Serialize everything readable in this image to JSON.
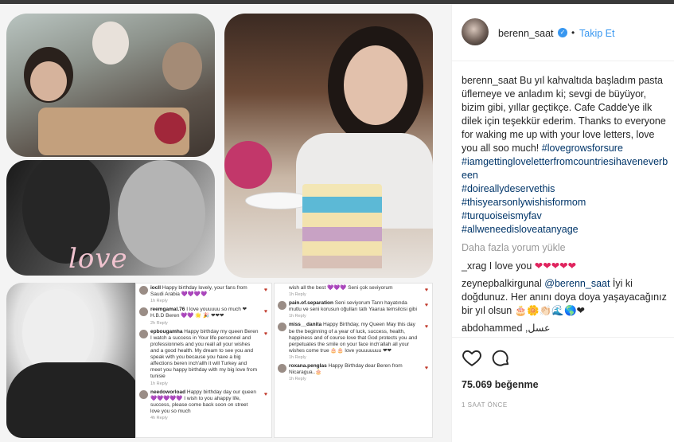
{
  "post": {
    "username": "berenn_saat",
    "follow_label": "Takip Et",
    "dot": "•",
    "verified_mark": "✓",
    "caption": "Bu yıl kahvaltıda başladım pasta üflemeye ve anladım ki; sevgi de büyüyor, bizim gibi, yıllar geçtikçe. Cafe Cadde'ye ilk dilek için teşekkür ederim. Thanks to everyone for waking me up with your love letters, love you all soo much!",
    "hashtags": [
      "#lovegrowsforsure",
      "#iamgettingloveletterfromcountriesihaveneverbeen",
      "#doireallydeservethis",
      "#thisyearsonlywishisformom",
      "#turquoiseismyfav",
      "#allweneedisloveatanyage"
    ],
    "load_more": "Daha fazla yorum yükle",
    "comments": [
      {
        "user": "_xrag",
        "text": "I love you ",
        "hearts": "❤❤❤❤❤"
      },
      {
        "user": "zeynepbalkirgunal",
        "mention": "@berenn_saat",
        "text": " İyi ki doğdunuz. Her anını doya doya yaşayacağınız bir yıl olsun ",
        "emoji": "🎂🌼👏🏻🌊🌎❤"
      },
      {
        "user": "abdohammed",
        "text": " ,عسل"
      }
    ],
    "likes": "75.069 beğenme",
    "time": "1 SAAT ÖNCE"
  },
  "collage": {
    "love_word": "love",
    "left_comments": [
      {
        "user": "iocll",
        "text": "Happy birthday lovely, your fans from Saudi Arabia 💜💜💜💜",
        "meta": "1h   Reply"
      },
      {
        "user": "reemgamal.76",
        "text": "I love youuuuu so much ❤ H.B.D Beren 💜💜 🌟 🎉 ❤❤❤",
        "meta": "2h   Reply"
      },
      {
        "user": "epbougamha",
        "text": "Happy birthday my queen Beren I watch a success in Your life personnel and professionnels and you reall all your wishes and a good health. My dream to see you and speak with you because you have a big affections beren inch'allh it will Turkey and meet you happy birthday with my big love from tunisie",
        "meta": "1h   Reply"
      },
      {
        "user": "needoworload",
        "text": "Happy birthday day our queen 💜💜💜💜💜 I wish to you ahappy life, success, please come back soon on street love you so much",
        "meta": "4h   Reply"
      }
    ],
    "right_comments": [
      {
        "user": "",
        "text": "wish all the best 💜💜💜 Seni çok seviyorum",
        "meta": "1h   Reply"
      },
      {
        "user": "pain.of.separation",
        "text": "Seni seviyorum Tanrı hayatında mutlu ve seni korusun oğulları tatlı Yaarua temsilcisi gibi",
        "meta": "1h   Reply"
      },
      {
        "user": "miss__danita",
        "text": "Happy Birthday, my Queen May this day be the beginning of a year of luck, success, health, happiness and of course love that God protects you and perpetuates the smile on your face inch'allah all your wishes come true 🎂🎂 love youuuuuuu ❤❤",
        "meta": "1h   Reply"
      },
      {
        "user": "roxana.penglas",
        "text": "Happy Birthday dear Beren from Nicaragua..🎂",
        "meta": "1h   Reply"
      }
    ]
  },
  "colors": {
    "link_blue": "#3897f0",
    "hashtag_blue": "#003569",
    "muted": "#999999",
    "heart_red": "#e0245e"
  }
}
